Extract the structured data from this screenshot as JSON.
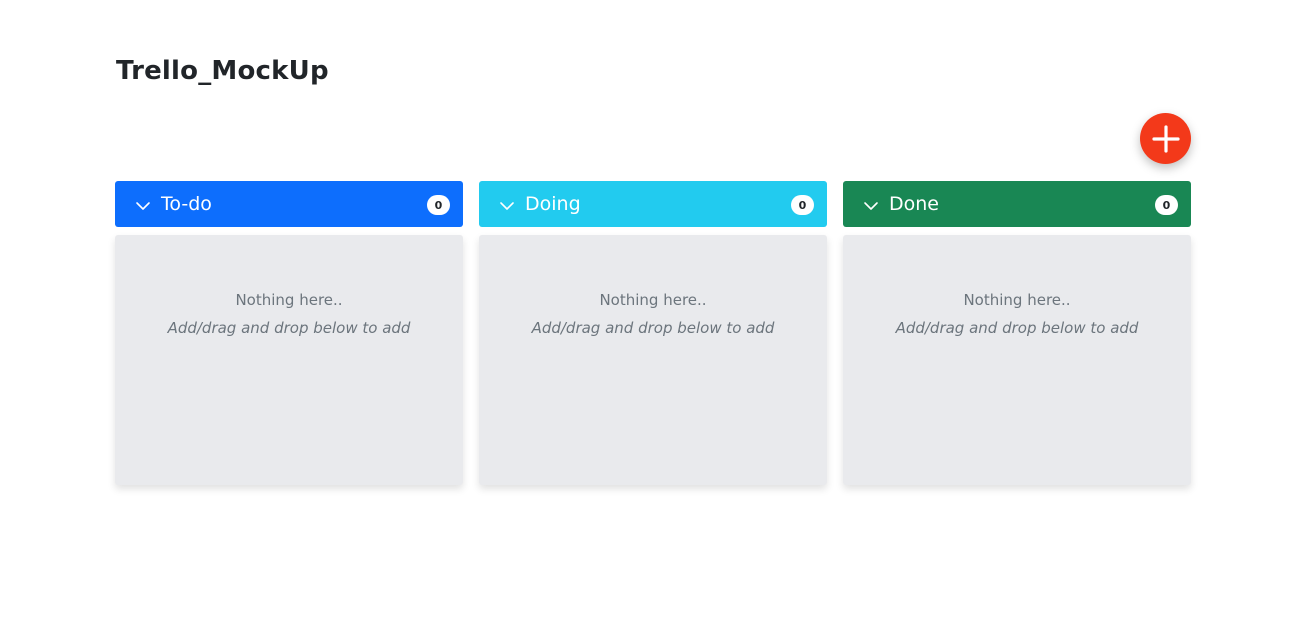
{
  "page": {
    "title": "Trello_MockUp"
  },
  "add_button": {
    "icon": "plus-icon",
    "color": "#f3391a"
  },
  "columns": [
    {
      "title": "To-do",
      "count": "0",
      "color": "#0d6efd",
      "empty_title": "Nothing here..",
      "empty_hint": "Add/drag and drop below to add"
    },
    {
      "title": "Doing",
      "count": "0",
      "color": "#22cbef",
      "empty_title": "Nothing here..",
      "empty_hint": "Add/drag and drop below to add"
    },
    {
      "title": "Done",
      "count": "0",
      "color": "#198754",
      "empty_title": "Nothing here..",
      "empty_hint": "Add/drag and drop below to add"
    }
  ]
}
